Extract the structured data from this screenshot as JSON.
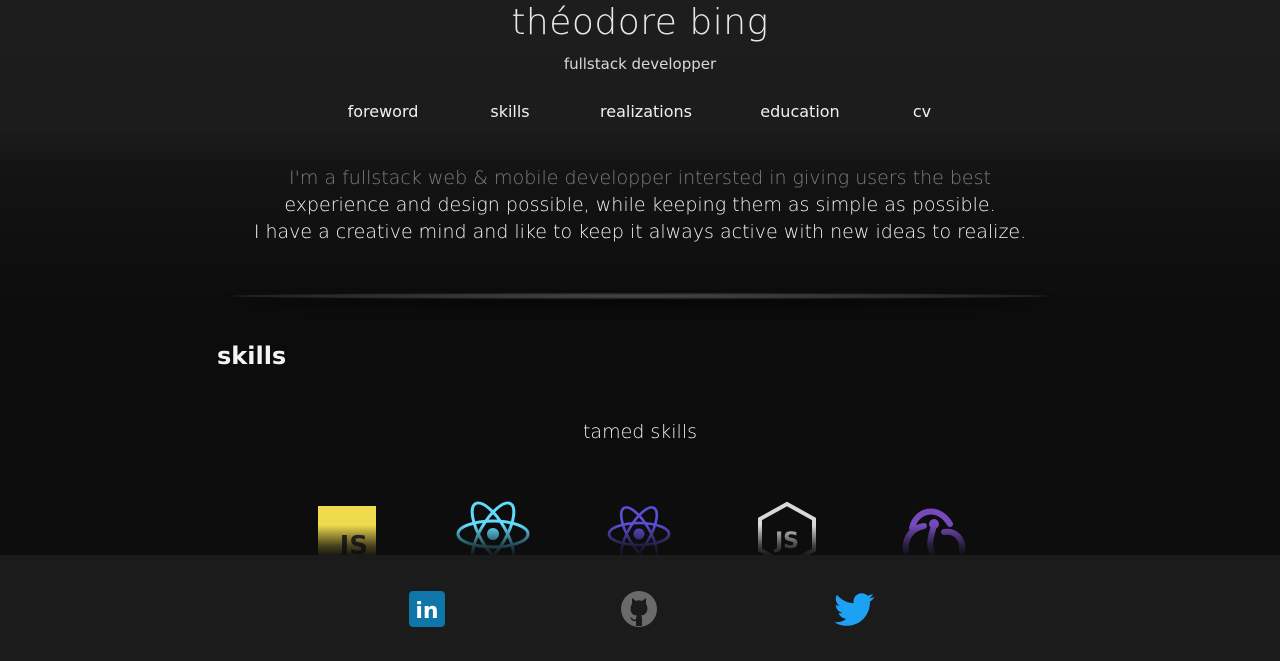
{
  "header": {
    "title": "théodore bing",
    "subtitle": "fullstack developper"
  },
  "nav": {
    "items": [
      {
        "label": "foreword"
      },
      {
        "label": "skills"
      },
      {
        "label": "realizations"
      },
      {
        "label": "education"
      },
      {
        "label": "cv"
      }
    ]
  },
  "foreword": {
    "lines": [
      "I'm a fullstack web & mobile developper intersted in giving users the best",
      "experience and design possible, while keeping them as simple as possible.",
      "I have a creative mind and like to keep it always active with new ideas to realize."
    ]
  },
  "skills": {
    "title": "skills",
    "subtitle": "tamed skills",
    "icons": [
      {
        "icon": "javascript-icon",
        "text": "JS"
      },
      {
        "icon": "react-icon"
      },
      {
        "icon": "react-native-icon"
      },
      {
        "icon": "nodejs-icon",
        "text": "JS"
      },
      {
        "icon": "redux-icon"
      }
    ]
  },
  "social": [
    {
      "icon": "linkedin-icon",
      "text": "in"
    },
    {
      "icon": "github-icon"
    },
    {
      "icon": "twitter-icon"
    }
  ],
  "colors": {
    "background": "#1b1b1b",
    "content_background": "#0d0d0d",
    "javascript": "#f0db4f",
    "react": "#61dafb",
    "react_native": "#5b4fd6",
    "redux": "#764abc",
    "linkedin": "#0e76a8",
    "twitter": "#1da1f2"
  }
}
